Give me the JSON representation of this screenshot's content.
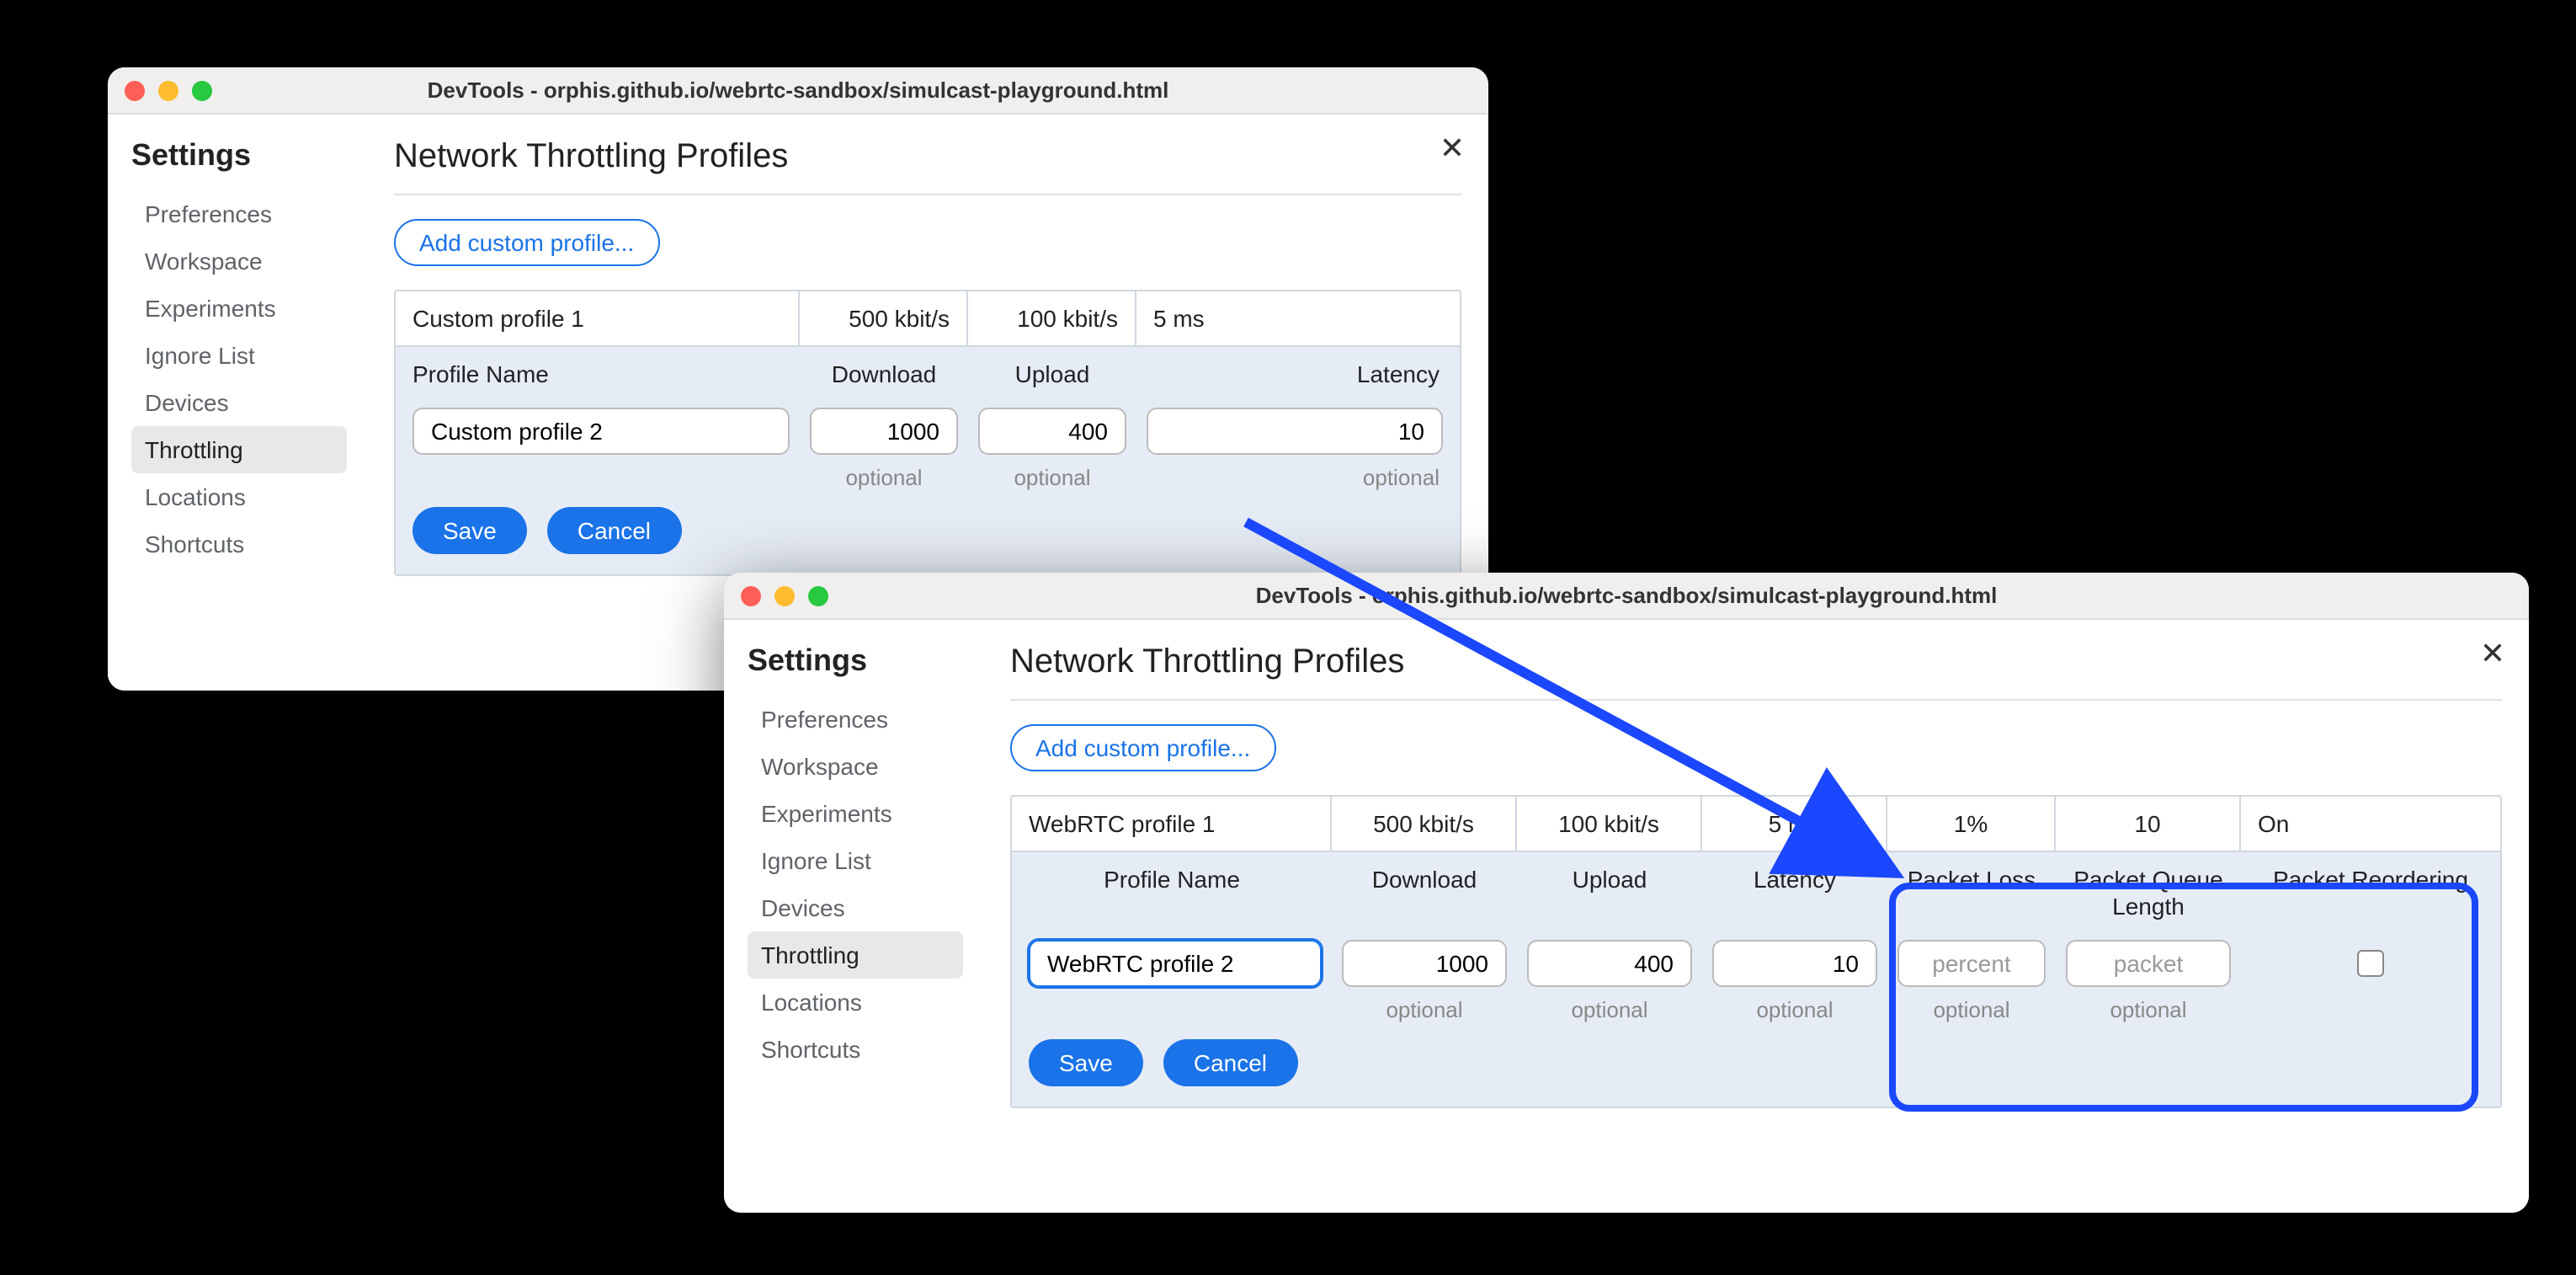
{
  "windowA": {
    "title": "DevTools - orphis.github.io/webrtc-sandbox/simulcast-playground.html",
    "sidebar": {
      "title": "Settings",
      "items": [
        "Preferences",
        "Workspace",
        "Experiments",
        "Ignore List",
        "Devices",
        "Throttling",
        "Locations",
        "Shortcuts"
      ],
      "active_index": 5
    },
    "page_title": "Network Throttling Profiles",
    "add_button": "Add custom profile...",
    "existing_row": {
      "name": "Custom profile 1",
      "download": "500 kbit/s",
      "upload": "100 kbit/s",
      "latency": "5 ms"
    },
    "headers": [
      "Profile Name",
      "Download",
      "Upload",
      "Latency"
    ],
    "edit_row": {
      "name": "Custom profile 2",
      "download": "1000",
      "upload": "400",
      "latency": "10"
    },
    "hints": [
      "optional",
      "optional",
      "optional"
    ],
    "save": "Save",
    "cancel": "Cancel"
  },
  "windowB": {
    "title": "DevTools - orphis.github.io/webrtc-sandbox/simulcast-playground.html",
    "sidebar": {
      "title": "Settings",
      "items": [
        "Preferences",
        "Workspace",
        "Experiments",
        "Ignore List",
        "Devices",
        "Throttling",
        "Locations",
        "Shortcuts"
      ],
      "active_index": 5
    },
    "page_title": "Network Throttling Profiles",
    "add_button": "Add custom profile...",
    "existing_row": {
      "name": "WebRTC profile 1",
      "download": "500 kbit/s",
      "upload": "100 kbit/s",
      "latency": "5 ms",
      "packet_loss": "1%",
      "queue_len": "10",
      "reorder": "On"
    },
    "headers": [
      "Profile Name",
      "Download",
      "Upload",
      "Packet Loss",
      "Latency",
      "Packet Queue Length",
      "Packet Reordering"
    ],
    "hdr": {
      "name": "Profile Name",
      "download": "Download",
      "upload": "Upload",
      "latency": "Latency",
      "packet_loss": "Packet Loss",
      "queue_len": "Packet Queue Length",
      "reorder": "Packet Reordering"
    },
    "edit_row": {
      "name": "WebRTC profile 2",
      "download": "1000",
      "upload": "400",
      "latency": "10",
      "packet_loss_ph": "percent",
      "queue_len_ph": "packet"
    },
    "hints": [
      "optional",
      "optional",
      "optional",
      "optional",
      "optional"
    ],
    "save": "Save",
    "cancel": "Cancel"
  }
}
